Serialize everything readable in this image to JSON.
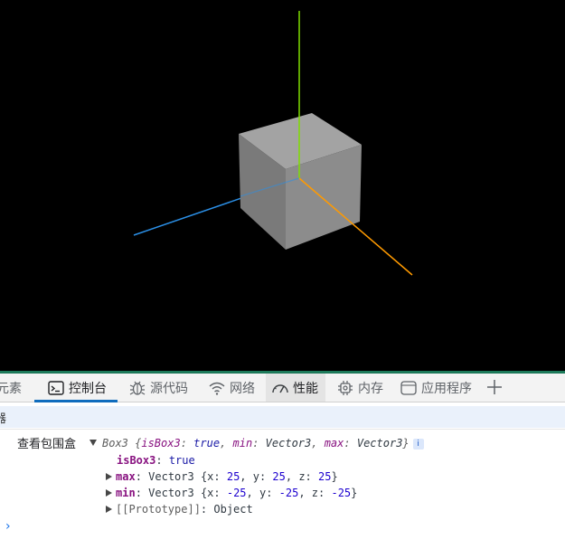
{
  "tabs": {
    "elements": "元素",
    "console": "控制台",
    "sources": "源代码",
    "network": "网络",
    "performance": "性能",
    "memory": "内存",
    "application": "应用程序"
  },
  "filter_bar": {
    "text": "器"
  },
  "console": {
    "log_label": "查看包围盒",
    "object_summary": {
      "class_name": "Box3",
      "open_brace": " {",
      "k1": "isBox3",
      "v1": "true",
      "k2": "min",
      "v2": "Vector3",
      "k3": "max",
      "v3": "Vector3",
      "close_brace": "}",
      "info_icon": "i"
    },
    "props": {
      "isBox3": {
        "key": "isBox3",
        "value": "true"
      },
      "max": {
        "key": "max",
        "type": "Vector3",
        "x": "25",
        "y": "25",
        "z": "25"
      },
      "min": {
        "key": "min",
        "type": "Vector3",
        "x": "-25",
        "y": "-25",
        "z": "-25"
      },
      "prototype": {
        "key": "[[Prototype]]",
        "value": "Object"
      }
    },
    "prompt": "›"
  },
  "colors": {
    "viewport_bg": "#000000",
    "cube_front": "#7a7a7a",
    "cube_top": "#a0a0a0",
    "cube_side": "#8e8e8e",
    "axis_x": "#ff9a00",
    "axis_y": "#7fdd00",
    "axis_z": "#2b8fe6",
    "active_tab": "#0f6cbd"
  },
  "icons": [
    "console-icon",
    "bug-icon",
    "wifi-icon",
    "gauge-icon",
    "chip-icon",
    "window-icon",
    "plus-icon",
    "expand-triangle-icon",
    "collapse-triangle-icon",
    "info-icon",
    "prompt-chevron-icon"
  ]
}
